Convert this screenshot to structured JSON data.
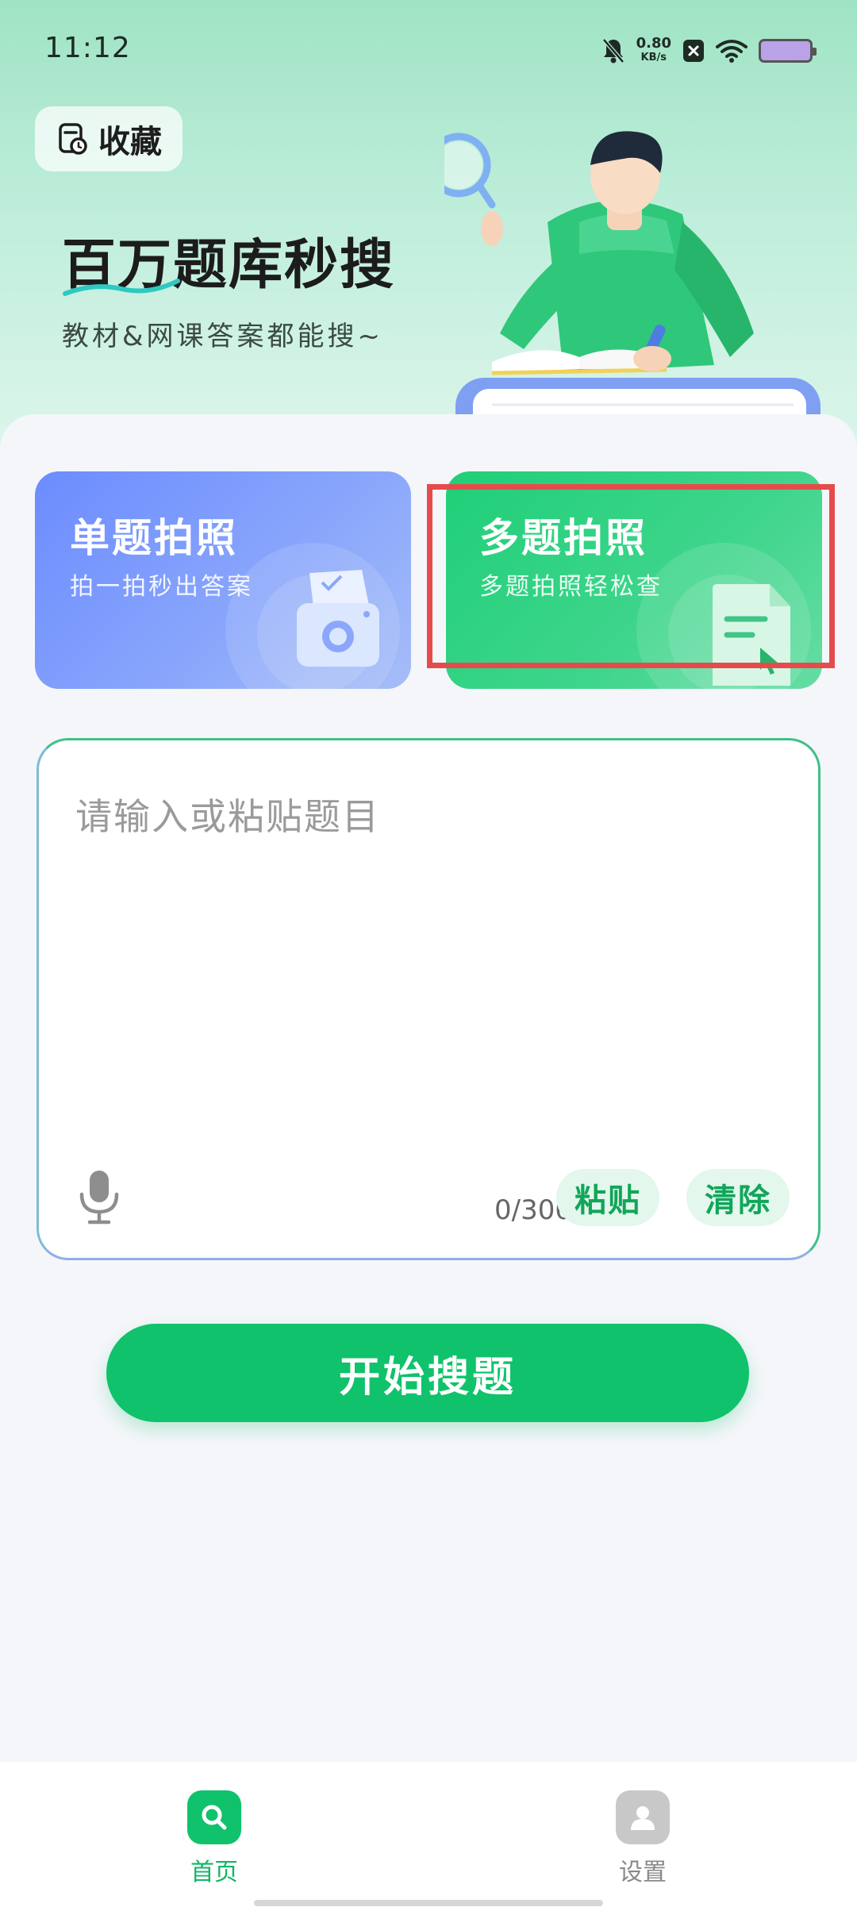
{
  "status_bar": {
    "time": "11:12",
    "net_speed_value": "0.80",
    "net_speed_unit": "KB/s",
    "icons": [
      "bell-muted-icon",
      "close-box-icon",
      "wifi-icon",
      "battery-icon"
    ]
  },
  "header": {
    "favorites_label": "收藏",
    "title": "百万题库秒搜",
    "subtitle": "教材&网课答案都能搜~"
  },
  "cards": {
    "single": {
      "title": "单题拍照",
      "desc": "拍一拍秒出答案"
    },
    "multi": {
      "title": "多题拍照",
      "desc": "多题拍照轻松查"
    }
  },
  "input": {
    "placeholder": "请输入或粘贴题目",
    "char_count": "0/300",
    "paste_label": "粘贴",
    "clear_label": "清除"
  },
  "search_button_label": "开始搜题",
  "bottom_nav": {
    "home_label": "首页",
    "settings_label": "设置"
  },
  "colors": {
    "brand_green": "#10c26b",
    "single_card_blue": "#6c8cff",
    "highlight_red": "#e64b4b"
  }
}
